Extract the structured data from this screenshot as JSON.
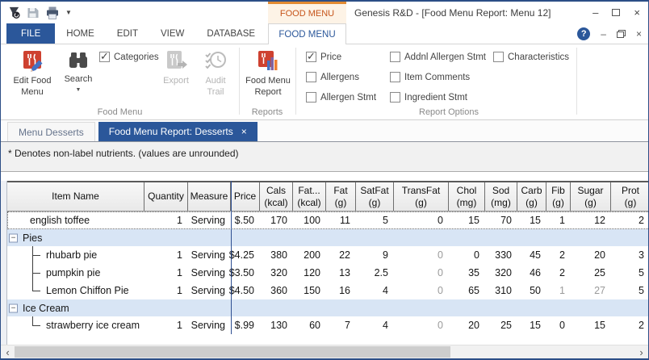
{
  "window": {
    "title": "Genesis R&D - [Food Menu Report: Menu 12]",
    "contextual_group_label": "FOOD MENU"
  },
  "glyphs": {
    "minimize": "–",
    "close": "×",
    "help": "?",
    "dropdown": "▼",
    "collapse": "−",
    "scroll_left": "‹",
    "scroll_right": "›",
    "doc_close": "×",
    "mdi_minimize": "–",
    "mdi_close": "×",
    "qat_dropdown": "▼"
  },
  "colors": {
    "accent_blue": "#2b579a",
    "contextual_orange": "#c6541a",
    "group_row_blue": "#d8e5f5",
    "frozen_divider": "#2e4f91",
    "edit_icon_red": "#ce4130"
  },
  "ribbon_tabs": [
    {
      "label": "FILE",
      "file": true,
      "active": false
    },
    {
      "label": "HOME",
      "active": false
    },
    {
      "label": "EDIT",
      "active": false
    },
    {
      "label": "VIEW",
      "active": false
    },
    {
      "label": "DATABASE",
      "active": false
    },
    {
      "label": "FOOD MENU",
      "active": true
    }
  ],
  "ribbon": {
    "food_menu_group": {
      "label": "Food Menu",
      "edit_button": "Edit Food Menu",
      "search_button": "Search",
      "categories_checkbox": {
        "label": "Categories",
        "checked": true
      },
      "export_button": "Export",
      "audit_button": "Audit Trail"
    },
    "reports_group": {
      "label": "Reports",
      "report_button": "Food Menu Report"
    },
    "options_group": {
      "label": "Report Options",
      "columns": [
        [
          {
            "label": "Price",
            "checked": true
          },
          {
            "label": "Allergens",
            "checked": false
          },
          {
            "label": "Allergen Stmt",
            "checked": false
          }
        ],
        [
          {
            "label": "Addnl Allergen Stmt",
            "checked": false
          },
          {
            "label": "Item Comments",
            "checked": false
          },
          {
            "label": "Ingredient Stmt",
            "checked": false
          }
        ],
        [
          {
            "label": "Characteristics",
            "checked": false
          }
        ]
      ]
    }
  },
  "doc_tabs": [
    {
      "label": "Menu Desserts",
      "active": false
    },
    {
      "label": "Food Menu Report: Desserts",
      "active": true,
      "closable": true
    }
  ],
  "note_bar": {
    "text": "* Denotes non-label nutrients. (values are unrounded)"
  },
  "table": {
    "columns": [
      {
        "label": "Item Name",
        "sub": ""
      },
      {
        "label": "Quantity",
        "sub": ""
      },
      {
        "label": "Measure",
        "sub": ""
      },
      {
        "label": "Price",
        "sub": ""
      },
      {
        "label": "Cals",
        "sub": "(kcal)"
      },
      {
        "label": "Fat...",
        "sub": "(kcal)"
      },
      {
        "label": "Fat",
        "sub": "(g)"
      },
      {
        "label": "SatFat",
        "sub": "(g)"
      },
      {
        "label": "TransFat",
        "sub": "(g)"
      },
      {
        "label": "Chol",
        "sub": "(mg)"
      },
      {
        "label": "Sod",
        "sub": "(mg)"
      },
      {
        "label": "Carb",
        "sub": "(g)"
      },
      {
        "label": "Fib",
        "sub": "(g)"
      },
      {
        "label": "Sugar",
        "sub": "(g)"
      },
      {
        "label": "Prot",
        "sub": "(g)"
      }
    ],
    "rows": [
      {
        "type": "item",
        "name": "english toffee",
        "branch": "none",
        "selected": true,
        "cells": [
          "1",
          "Serving",
          "$.50",
          "170",
          "100",
          "11",
          "5",
          "0",
          "15",
          "70",
          "15",
          "1",
          "12",
          "2"
        ],
        "muted": []
      },
      {
        "type": "group",
        "name": "Pies"
      },
      {
        "type": "item",
        "name": "rhubarb pie",
        "branch": "mid",
        "selected": false,
        "cells": [
          "1",
          "Serving",
          "$4.25",
          "380",
          "200",
          "22",
          "9",
          "0",
          "0",
          "330",
          "45",
          "2",
          "20",
          "3"
        ],
        "muted": [
          7
        ]
      },
      {
        "type": "item",
        "name": "pumpkin pie",
        "branch": "mid",
        "selected": false,
        "cells": [
          "1",
          "Serving",
          "$3.50",
          "320",
          "120",
          "13",
          "2.5",
          "0",
          "35",
          "320",
          "46",
          "2",
          "25",
          "5"
        ],
        "muted": [
          7
        ]
      },
      {
        "type": "item",
        "name": "Lemon Chiffon Pie",
        "branch": "last",
        "selected": false,
        "cells": [
          "1",
          "Serving",
          "$4.50",
          "360",
          "150",
          "16",
          "4",
          "0",
          "65",
          "310",
          "50",
          "1",
          "27",
          "5"
        ],
        "muted": [
          7,
          11,
          12
        ]
      },
      {
        "type": "group",
        "name": "Ice Cream"
      },
      {
        "type": "item",
        "name": "strawberry ice cream",
        "branch": "last",
        "selected": false,
        "cells": [
          "1",
          "Serving",
          "$.99",
          "130",
          "60",
          "7",
          "4",
          "0",
          "20",
          "25",
          "15",
          "0",
          "15",
          "2"
        ],
        "muted": [
          7
        ]
      }
    ]
  }
}
